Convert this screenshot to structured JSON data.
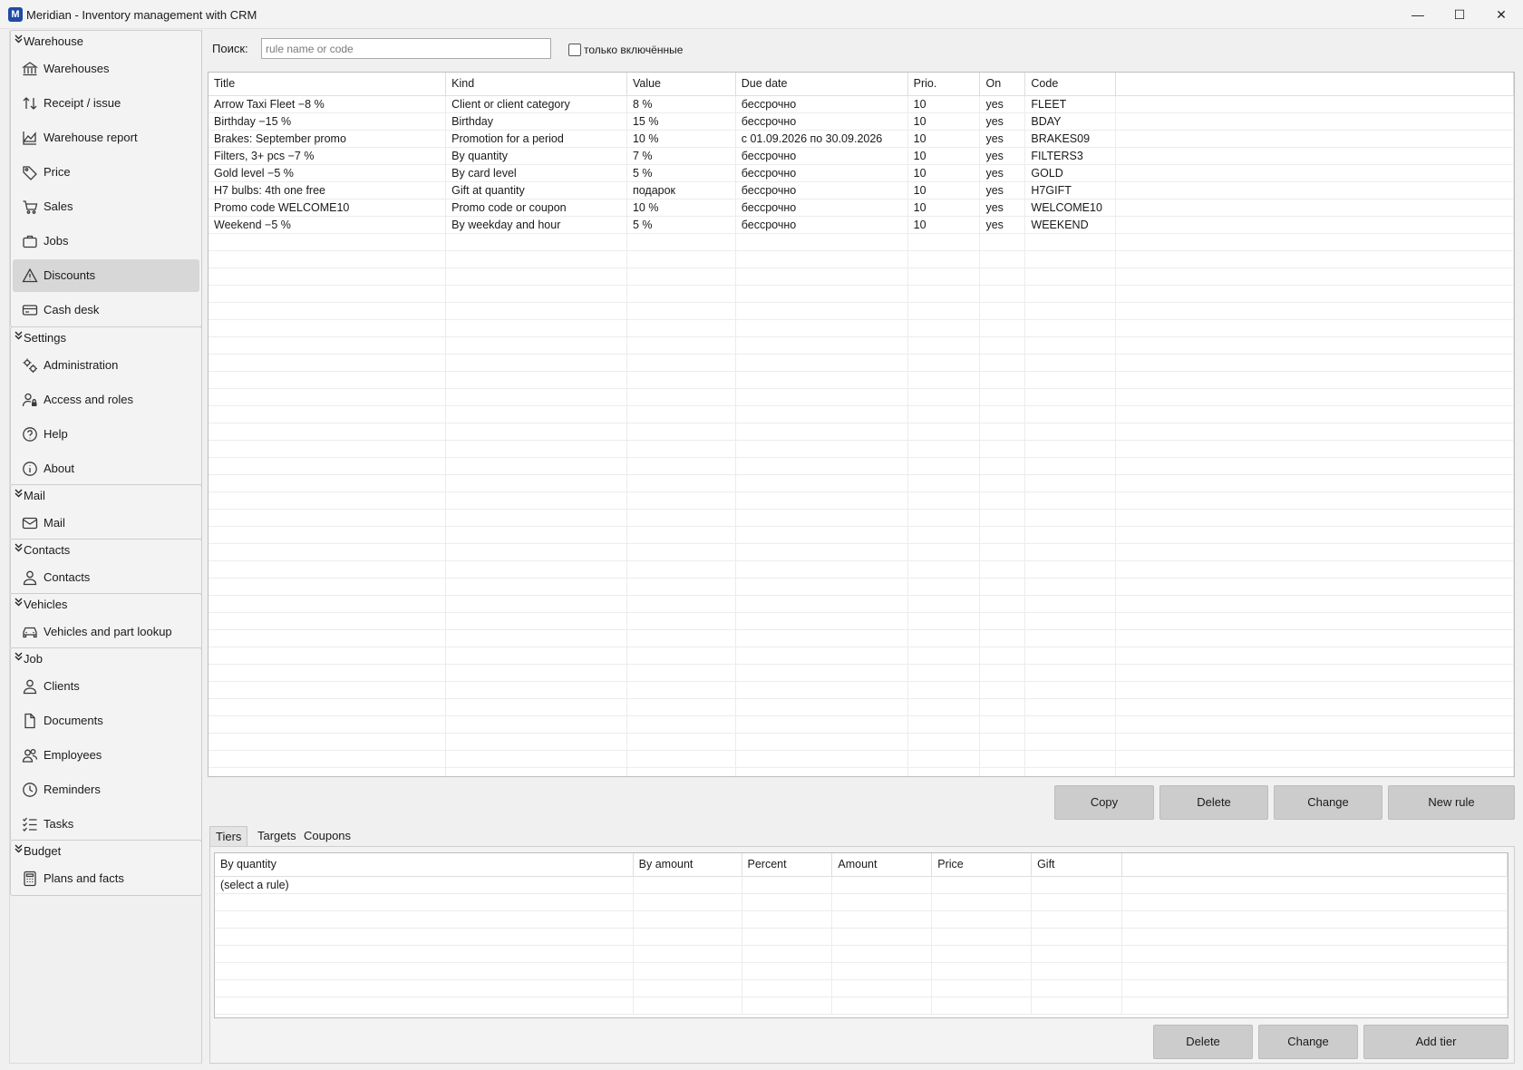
{
  "window": {
    "title": "Meridian - Inventory management with CRM",
    "icon_letter": "M",
    "controls": {
      "minimize": "—",
      "maximize": "☐",
      "close": "✕"
    }
  },
  "sidebar": {
    "groups": [
      {
        "title": "Warehouse",
        "items": [
          {
            "label": "Warehouses",
            "icon": "bank-icon"
          },
          {
            "label": "Receipt / issue",
            "icon": "arrows-updown-icon"
          },
          {
            "label": "Warehouse report",
            "icon": "chart-area-icon"
          },
          {
            "label": "Price",
            "icon": "tag-icon"
          },
          {
            "label": "Sales",
            "icon": "cart-icon"
          },
          {
            "label": "Jobs",
            "icon": "briefcase-icon"
          },
          {
            "label": "Discounts",
            "icon": "warning-icon",
            "selected": true
          },
          {
            "label": "Cash desk",
            "icon": "card-icon"
          }
        ]
      },
      {
        "title": "Settings",
        "items": [
          {
            "label": "Administration",
            "icon": "gears-icon"
          },
          {
            "label": "Access and roles",
            "icon": "user-lock-icon"
          },
          {
            "label": "Help",
            "icon": "help-icon"
          },
          {
            "label": "About",
            "icon": "info-icon"
          }
        ]
      },
      {
        "title": "Mail",
        "items": [
          {
            "label": "Mail",
            "icon": "mail-icon"
          }
        ]
      },
      {
        "title": "Contacts",
        "items": [
          {
            "label": "Contacts",
            "icon": "person-icon"
          }
        ]
      },
      {
        "title": "Vehicles",
        "items": [
          {
            "label": "Vehicles and part lookup",
            "icon": "car-icon"
          }
        ]
      },
      {
        "title": "Job",
        "items": [
          {
            "label": "Clients",
            "icon": "person-icon"
          },
          {
            "label": "Documents",
            "icon": "document-icon"
          },
          {
            "label": "Employees",
            "icon": "people-icon"
          },
          {
            "label": "Reminders",
            "icon": "clock-icon"
          },
          {
            "label": "Tasks",
            "icon": "checklist-icon"
          }
        ]
      },
      {
        "title": "Budget",
        "items": [
          {
            "label": "Plans and facts",
            "icon": "calculator-icon"
          }
        ]
      }
    ]
  },
  "search": {
    "label": "Поиск:",
    "value": "",
    "placeholder": "rule name or code",
    "only_enabled_label": "только включённые",
    "only_enabled_checked": false
  },
  "rules_table": {
    "columns": [
      "Title",
      "Kind",
      "Value",
      "Due date",
      "Prio.",
      "On",
      "Code"
    ],
    "rows": [
      [
        "Arrow Taxi Fleet −8 %",
        "Client or client category",
        "8 %",
        "бессрочно",
        "10",
        "yes",
        "FLEET"
      ],
      [
        "Birthday −15 %",
        "Birthday",
        "15 %",
        "бессрочно",
        "10",
        "yes",
        "BDAY"
      ],
      [
        "Brakes: September promo",
        "Promotion for a period",
        "10 %",
        "с 01.09.2026 по 30.09.2026",
        "10",
        "yes",
        "BRAKES09"
      ],
      [
        "Filters, 3+ pcs −7 %",
        "By quantity",
        "7 %",
        "бессрочно",
        "10",
        "yes",
        "FILTERS3"
      ],
      [
        "Gold level −5 %",
        "By card level",
        "5 %",
        "бессрочно",
        "10",
        "yes",
        "GOLD"
      ],
      [
        "H7 bulbs: 4th one free",
        "Gift at quantity",
        "подарок",
        "бессрочно",
        "10",
        "yes",
        "H7GIFT"
      ],
      [
        "Promo code WELCOME10",
        "Promo code or coupon",
        "10 %",
        "бессрочно",
        "10",
        "yes",
        "WELCOME10"
      ],
      [
        "Weekend −5 %",
        "By weekday and hour",
        "5 %",
        "бессрочно",
        "10",
        "yes",
        "WEEKEND"
      ]
    ]
  },
  "rule_buttons": {
    "copy": "Copy",
    "delete": "Delete",
    "change": "Change",
    "new_rule": "New rule"
  },
  "detail_tabs": [
    {
      "label": "Tiers",
      "active": true
    },
    {
      "label": "Targets",
      "active": false
    },
    {
      "label": "Coupons",
      "active": false
    }
  ],
  "tiers_table": {
    "columns": [
      "By quantity",
      "By amount",
      "Percent",
      "Amount",
      "Price",
      "Gift"
    ],
    "rows": [
      [
        "(select a rule)",
        "",
        "",
        "",
        "",
        ""
      ]
    ]
  },
  "tier_buttons": {
    "delete": "Delete",
    "change": "Change",
    "add_tier": "Add tier"
  }
}
